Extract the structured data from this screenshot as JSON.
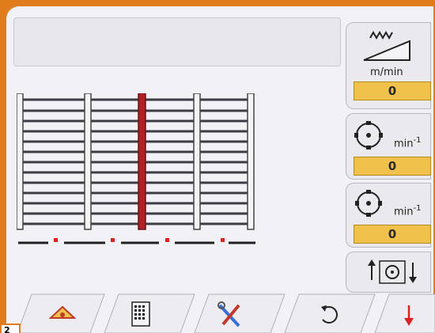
{
  "speed_panel": {
    "unit": "m/min",
    "value": "0"
  },
  "rpm_panel_1": {
    "unit": "min",
    "unit_exp": "-1",
    "value": "0"
  },
  "rpm_panel_2": {
    "unit": "min",
    "unit_exp": "-1",
    "value": "0"
  },
  "corner_label": "2",
  "colors": {
    "frame_accent": "#b21f24",
    "value_field": "#f0c24c",
    "alarm": "#e02020",
    "border": "#e07c1c"
  },
  "tabs": [
    {
      "icon": "home-machine-icon"
    },
    {
      "icon": "calculator-icon"
    },
    {
      "icon": "tools-icon"
    },
    {
      "icon": "reset-icon"
    },
    {
      "icon": "arrow-down-alarm-icon"
    }
  ]
}
